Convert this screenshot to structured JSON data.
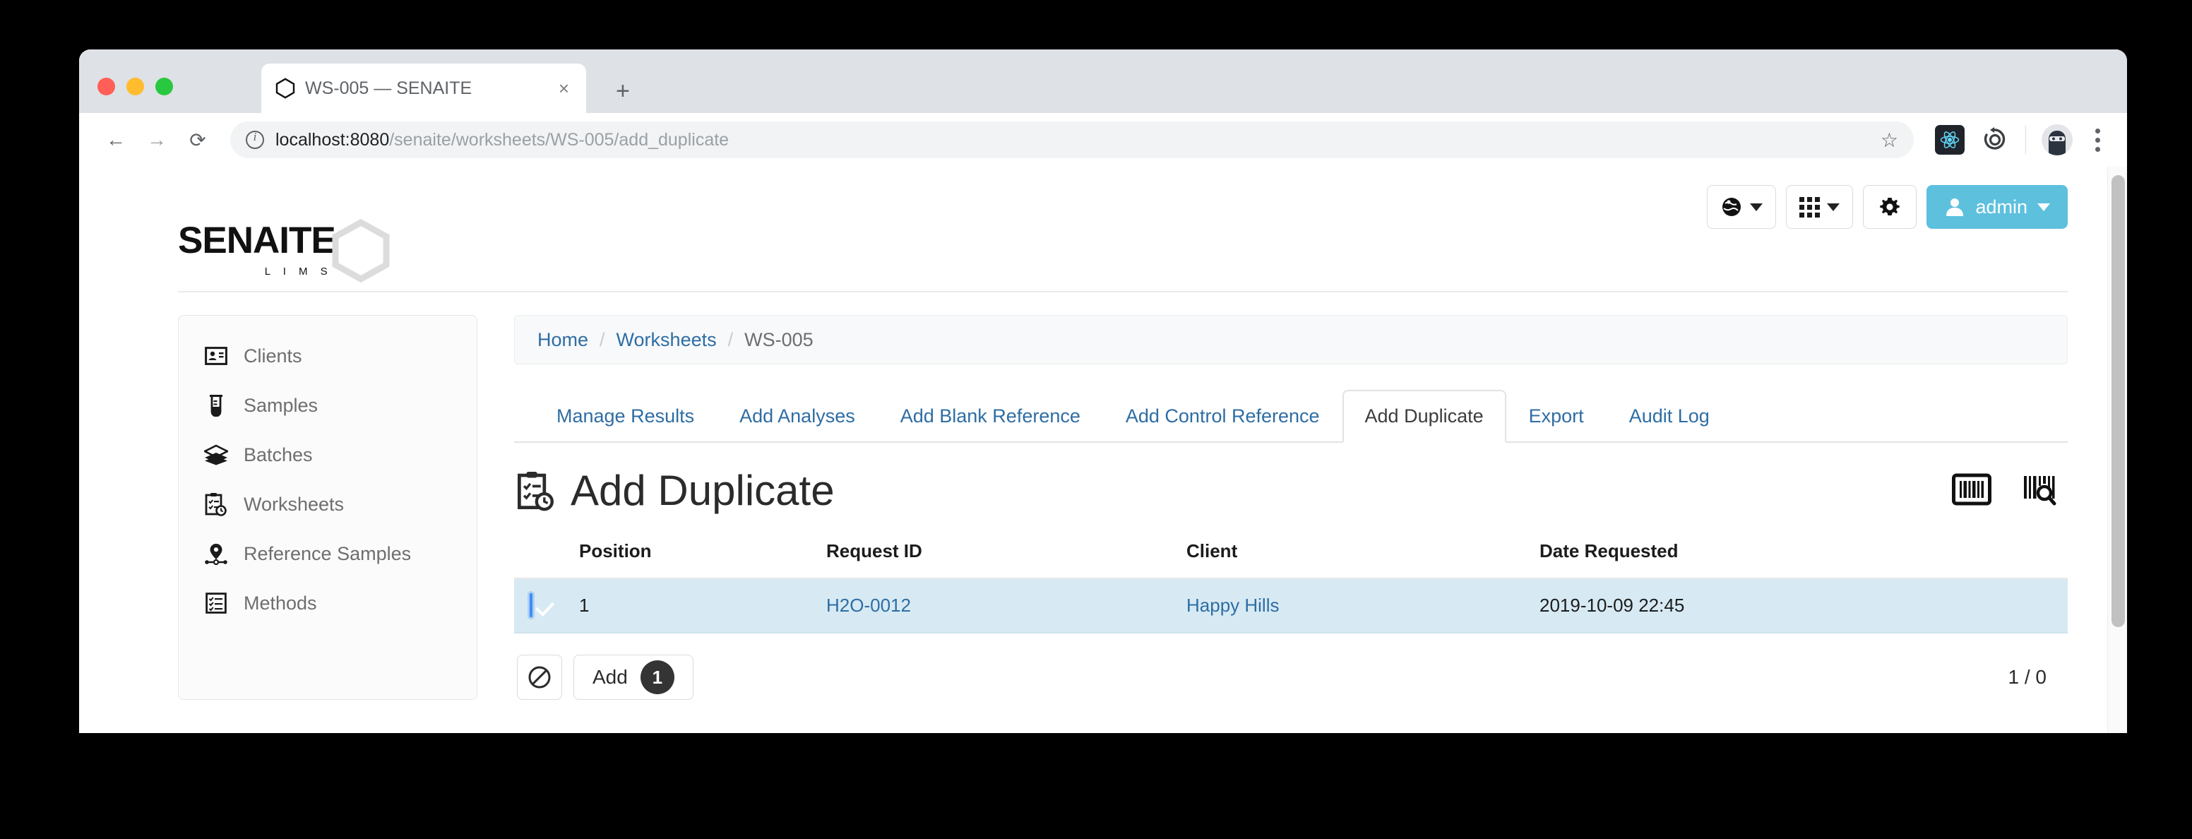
{
  "browser": {
    "tab": {
      "title": "WS-005 — SENAITE",
      "favicon": "hexagon-icon",
      "close": "×"
    },
    "new_tab_label": "+",
    "nav": {
      "back": "←",
      "forward": "→",
      "reload": "⟳"
    },
    "omnibox": {
      "info_icon": "site-info-icon",
      "host": "localhost:8080",
      "path": "/senaite/worksheets/WS-005/add_duplicate",
      "star_icon": "☆"
    },
    "extensions": [
      "react-devtools-icon",
      "sync-extension-icon",
      "profile-avatar-icon"
    ],
    "menu_icon": "kebab-menu-icon"
  },
  "header": {
    "logo": {
      "word": "SENAITE",
      "sub": "L I M S"
    },
    "tools": [
      {
        "name": "language-switcher",
        "icon": "globe-icon",
        "caret": true
      },
      {
        "name": "apps-menu",
        "icon": "grid-icon",
        "caret": true
      },
      {
        "name": "settings",
        "icon": "gear-icon",
        "caret": false
      }
    ],
    "user": {
      "label": "admin",
      "icon": "user-icon",
      "color": "#5dc0dd"
    }
  },
  "sidebar": {
    "items": [
      {
        "label": "Clients",
        "icon": "id-card-icon"
      },
      {
        "label": "Samples",
        "icon": "test-tube-icon"
      },
      {
        "label": "Batches",
        "icon": "layers-icon"
      },
      {
        "label": "Worksheets",
        "icon": "clipboard-clock-icon"
      },
      {
        "label": "Reference Samples",
        "icon": "map-marker-icon"
      },
      {
        "label": "Methods",
        "icon": "checklist-icon"
      }
    ]
  },
  "breadcrumb": {
    "items": [
      "Home",
      "Worksheets",
      "WS-005"
    ],
    "separator": "/"
  },
  "tabs": {
    "items": [
      {
        "label": "Manage Results",
        "active": false
      },
      {
        "label": "Add Analyses",
        "active": false
      },
      {
        "label": "Add Blank Reference",
        "active": false
      },
      {
        "label": "Add Control Reference",
        "active": false
      },
      {
        "label": "Add Duplicate",
        "active": true
      },
      {
        "label": "Export",
        "active": false
      },
      {
        "label": "Audit Log",
        "active": false
      }
    ]
  },
  "page": {
    "title": "Add Duplicate",
    "title_icon": "clipboard-clock-icon",
    "actions": [
      {
        "name": "barcode-icon"
      },
      {
        "name": "barcode-scan-icon"
      }
    ]
  },
  "table": {
    "columns": [
      "",
      "Position",
      "Request ID",
      "Client",
      "Date Requested"
    ],
    "rows": [
      {
        "checked": true,
        "position": "1",
        "request_id": "H2O-0012",
        "client": "Happy Hills",
        "date_requested": "2019-10-09 22:45"
      }
    ],
    "row_highlight": "#d7eaf3",
    "link_color": "#2e6da4"
  },
  "footer": {
    "clear_button": {
      "icon": "ban-icon",
      "label": ""
    },
    "add_button": {
      "label": "Add",
      "count": "1"
    },
    "pager": "1 / 0"
  }
}
